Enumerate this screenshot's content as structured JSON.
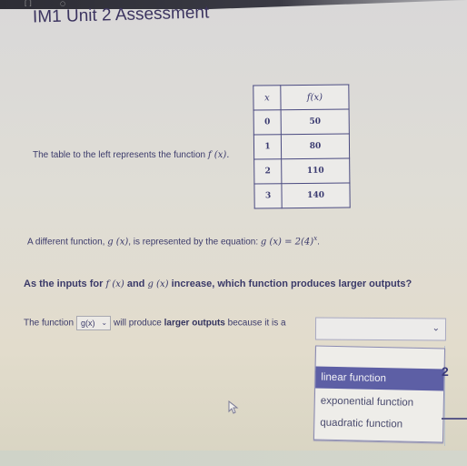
{
  "page": {
    "title": "IM1 Unit 2 Assessment"
  },
  "table": {
    "headers": [
      "x",
      "f(x)"
    ],
    "rows": [
      {
        "x": "0",
        "fx": "50"
      },
      {
        "x": "1",
        "fx": "80"
      },
      {
        "x": "2",
        "fx": "110"
      },
      {
        "x": "3",
        "fx": "140"
      }
    ]
  },
  "question": {
    "intro_text": "The table to the left represents the function",
    "intro_fn": "f (x).",
    "g_text_a": "A different function,",
    "g_fn": "g (x)",
    "g_text_b": ", is represented by the equation:",
    "g_equation": "g (x) = 2(4)",
    "g_exponent": "x",
    "g_end": ".",
    "prompt_a": "As the inputs for",
    "prompt_f": "f (x)",
    "prompt_and": "and",
    "prompt_g": "g (x)",
    "prompt_b": "increase, which function produces larger outputs?",
    "answer_a": "The function",
    "answer_b": "will produce",
    "answer_bold": "larger outputs",
    "answer_c": "because it is a"
  },
  "function_select": {
    "value": "g(x)"
  },
  "type_select": {
    "value": "",
    "options": [
      "linear function",
      "exponential function",
      "quadratic function"
    ],
    "highlighted": "linear function"
  },
  "side": {
    "number": "2"
  },
  "colors": {
    "highlight": "#5d5fa5",
    "text": "#3b3a6a"
  }
}
